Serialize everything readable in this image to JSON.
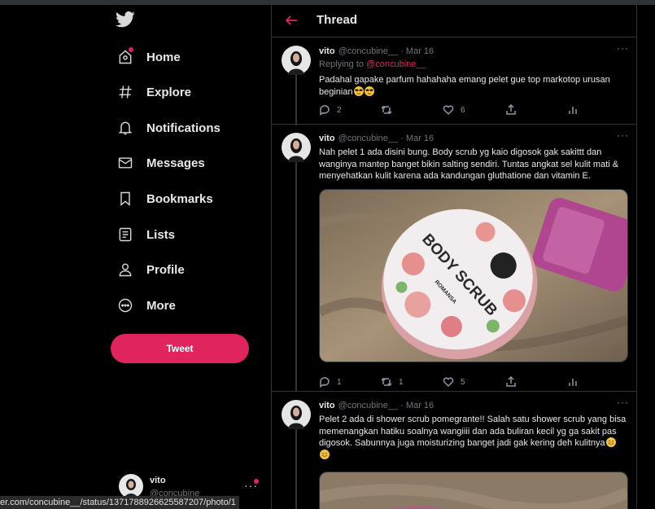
{
  "sidebar": {
    "nav": [
      {
        "label": "Home",
        "icon": "home-icon"
      },
      {
        "label": "Explore",
        "icon": "hashtag-icon"
      },
      {
        "label": "Notifications",
        "icon": "bell-icon"
      },
      {
        "label": "Messages",
        "icon": "envelope-icon"
      },
      {
        "label": "Bookmarks",
        "icon": "bookmark-icon"
      },
      {
        "label": "Lists",
        "icon": "list-icon"
      },
      {
        "label": "Profile",
        "icon": "person-icon"
      },
      {
        "label": "More",
        "icon": "more-circle-icon"
      }
    ],
    "tweet_button": "Tweet",
    "account": {
      "name": "vito",
      "handle": "@concubine"
    }
  },
  "status_url": "er.com/concubine__/status/1371788926625587207/photo/1",
  "header": {
    "title": "Thread"
  },
  "tweets": [
    {
      "name": "vito",
      "handle": "@concubine__",
      "date": "· Mar 16",
      "replying_prefix": "Replying to ",
      "replying_to": "@concubine__",
      "text": "Padahal gapake parfum hahahaha emang pelet gue top markotop urusan beginian",
      "replies": "2",
      "retweets": "",
      "likes": "6"
    },
    {
      "name": "vito",
      "handle": "@concubine__",
      "date": "· Mar 16",
      "text": "Nah pelet 1 ada disini bung. Body scrub yg kaio digosok gak sakittt dan wanginya mantep banget bikin salting sendiri. Tuntas angkat sel kulit mati & menyehatkan kulit karena ada kandungan gluthatione dan vitamin E.",
      "photo_label": "BODY SCRUB",
      "photo_sublabel": "ROMANSA",
      "replies": "1",
      "retweets": "1",
      "likes": "5"
    },
    {
      "name": "vito",
      "handle": "@concubine__",
      "date": "· Mar 16",
      "text": "Pelet 2 ada di shower scrub pomegrante!! Salah satu shower scrub yang bisa memenangkan hatiku soalnya wangiiii dan ada buliran kecil yg ga sakit pas digosok. Sabunnya juga moisturizing banget jadi gak kering deh kulitnya"
    }
  ],
  "colors": {
    "accent": "#e0245e",
    "background": "#000000",
    "border": "#2f3336",
    "muted": "#6e767d"
  }
}
